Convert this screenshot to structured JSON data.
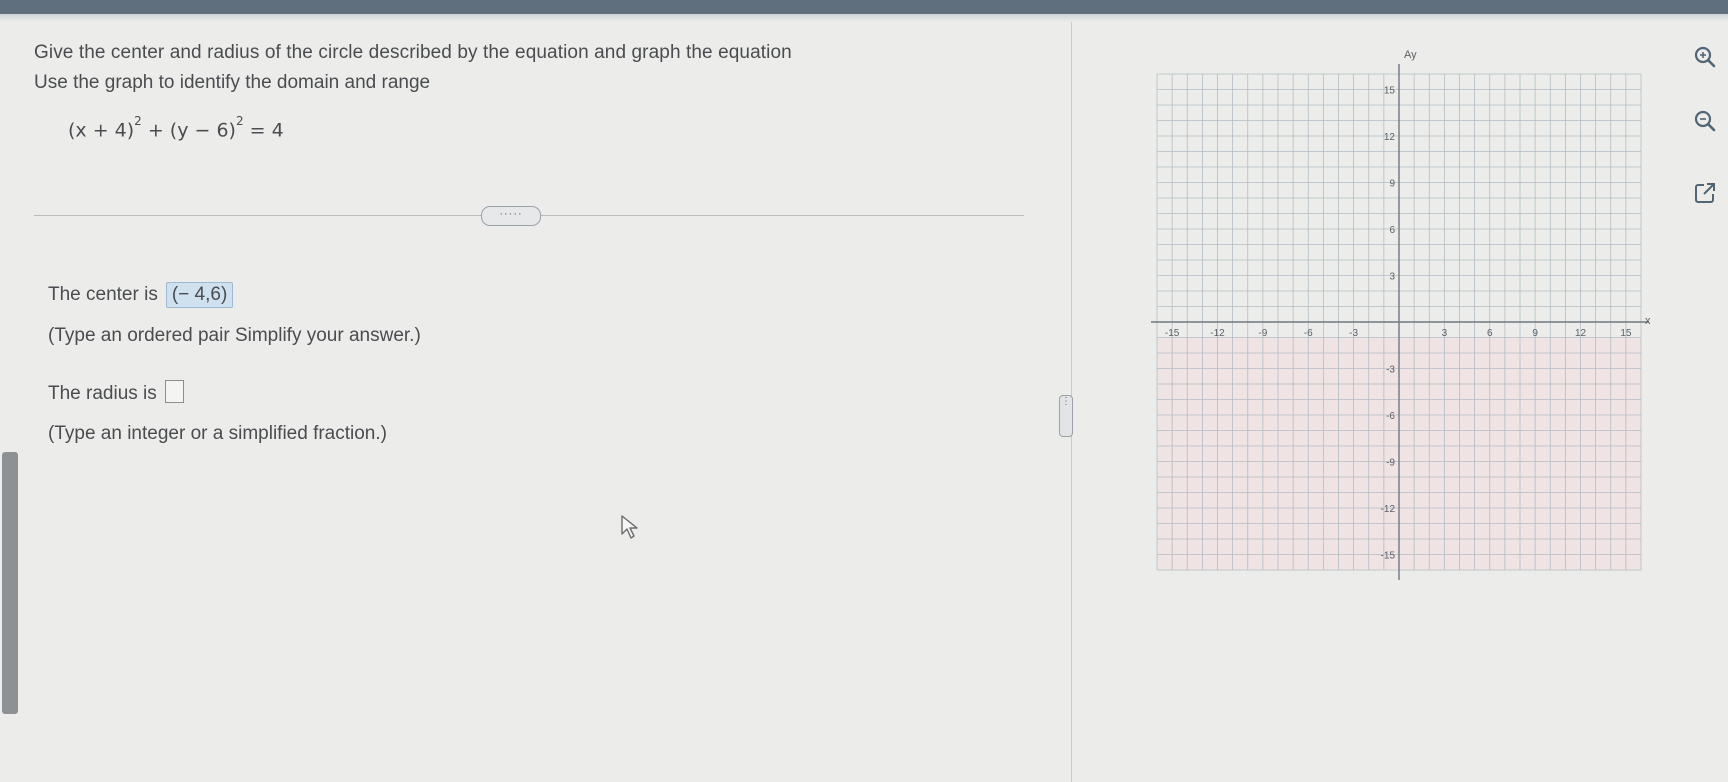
{
  "question": {
    "line1": "Give the center and radius of the circle described by the equation and graph the equation",
    "line2": "Use the graph to identify the domain and range",
    "equation": {
      "part1": "(x + 4)",
      "exp1": "2",
      "part2": " + (y − 6)",
      "exp2": "2",
      "part3": " = 4"
    }
  },
  "expand_button_label": "·····",
  "answers": {
    "center_prefix": "The center is",
    "center_value": "(− 4,6)",
    "center_hint": "(Type an ordered pair  Simplify your answer.)",
    "radius_prefix": "The radius is",
    "radius_value": "",
    "radius_hint": "(Type an integer or a simplified fraction.)"
  },
  "graph": {
    "x_axis_label": "x",
    "y_axis_label": "Ay",
    "x_range": [
      -16,
      16
    ],
    "y_range": [
      -16,
      16
    ],
    "grid_step": 1,
    "x_tick_labels": [
      "-15",
      "-12",
      "-9",
      "-6",
      "-3",
      "3",
      "6",
      "9",
      "12",
      "15"
    ],
    "y_tick_labels": [
      "15",
      "12",
      "9",
      "6",
      "3",
      "-3",
      "-6",
      "-9",
      "-12",
      "-15"
    ],
    "colors": {
      "grid": "#b3bcc4",
      "axis": "#6f7880",
      "lower_half_tint": "#efe3e4"
    }
  },
  "toolbar": {
    "tools": [
      {
        "icon": "zoom-in-icon"
      },
      {
        "icon": "zoom-out-icon"
      },
      {
        "icon": "external-link-icon"
      }
    ]
  }
}
